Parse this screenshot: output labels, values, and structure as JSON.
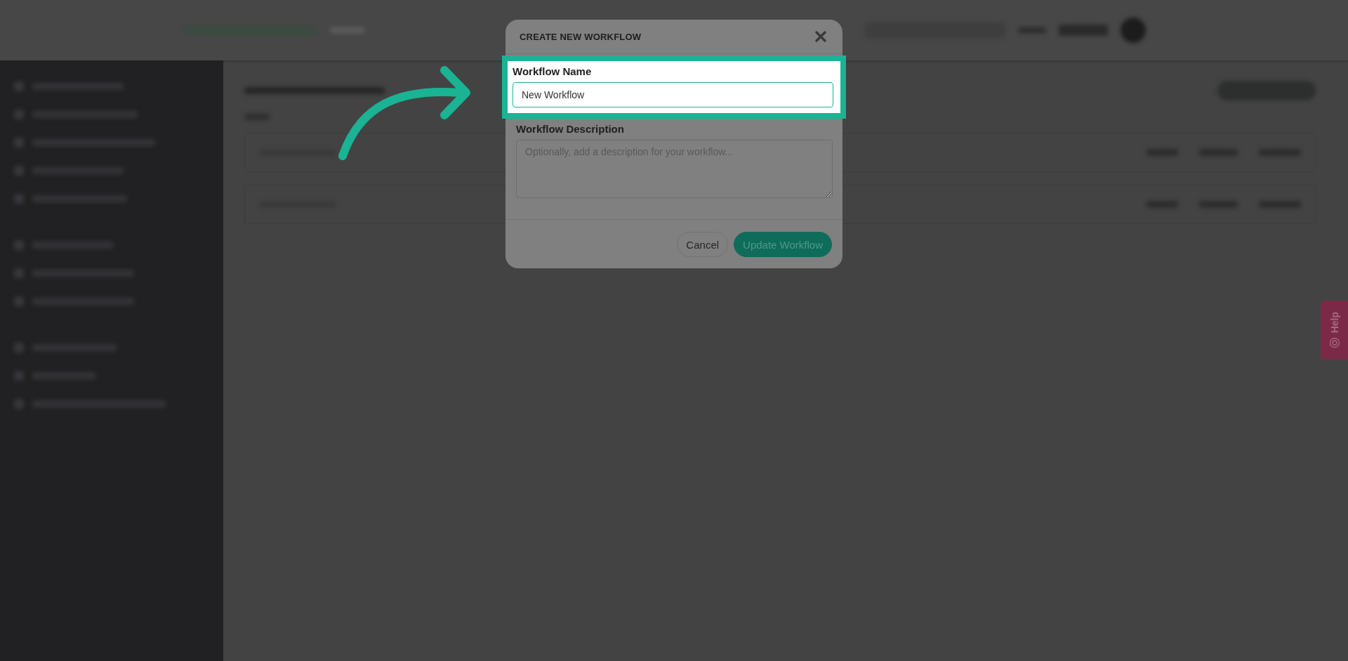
{
  "modal": {
    "title": "CREATE NEW WORKFLOW",
    "fields": [
      {
        "kind": "input",
        "label": "Workflow Name",
        "value": "New Workflow",
        "highlighted": true
      },
      {
        "kind": "textarea",
        "label": "Workflow Description",
        "placeholder": "Optionally, add a description for your workflow...",
        "highlighted": false
      }
    ],
    "buttons": [
      {
        "label": "Cancel",
        "kind": "secondary"
      },
      {
        "label": "Update Workflow",
        "kind": "primary"
      }
    ]
  },
  "help_tab": {
    "label": "Help"
  }
}
